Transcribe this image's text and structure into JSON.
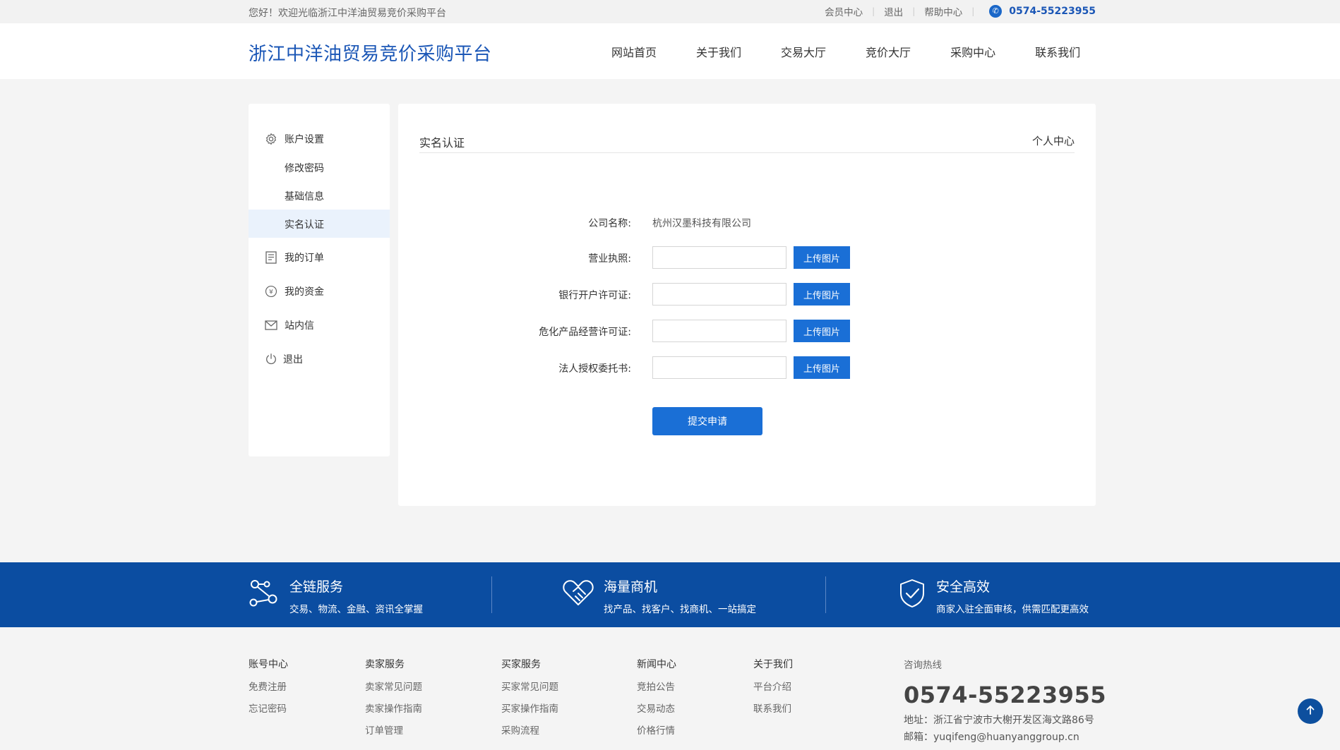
{
  "topbar": {
    "welcome": "您好！欢迎光临浙江中洋油贸易竞价采购平台",
    "links": [
      "会员中心",
      "退出",
      "帮助中心"
    ],
    "phone": "0574-55223955"
  },
  "header": {
    "site_title": "浙江中洋油贸易竞价采购平台",
    "nav": [
      "网站首页",
      "关于我们",
      "交易大厅",
      "竞价大厅",
      "采购中心",
      "联系我们"
    ]
  },
  "sidebar": {
    "account_settings": "账户设置",
    "sub_items": [
      "修改密码",
      "基础信息",
      "实名认证"
    ],
    "active_sub": "实名认证",
    "my_orders": "我的订单",
    "my_funds": "我的资金",
    "messages": "站内信",
    "logout": "退出"
  },
  "main": {
    "title": "实名认证",
    "breadcrumb": "个人中心",
    "company_label": "公司名称:",
    "company_value": "杭州汉墨科技有限公司",
    "upload_rows": [
      {
        "label": "营业执照:",
        "button": "上传图片"
      },
      {
        "label": "银行开户许可证:",
        "button": "上传图片"
      },
      {
        "label": "危化产品经营许可证:",
        "button": "上传图片"
      },
      {
        "label": "法人授权委托书:",
        "button": "上传图片"
      }
    ],
    "submit": "提交申请"
  },
  "features": [
    {
      "title": "全链服务",
      "desc": "交易、物流、金融、资讯全掌握",
      "icon": "network-nodes-icon"
    },
    {
      "title": "海量商机",
      "desc": "找产品、找客户、找商机、一站搞定",
      "icon": "handshake-heart-icon"
    },
    {
      "title": "安全高效",
      "desc": "商家入驻全面审核，供需匹配更高效",
      "icon": "shield-check-icon"
    }
  ],
  "footer": {
    "columns": [
      {
        "head": "账号中心",
        "links": [
          "免费注册",
          "忘记密码"
        ]
      },
      {
        "head": "卖家服务",
        "links": [
          "卖家常见问题",
          "卖家操作指南",
          "订单管理"
        ]
      },
      {
        "head": "买家服务",
        "links": [
          "买家常见问题",
          "买家操作指南",
          "采购流程"
        ]
      },
      {
        "head": "新闻中心",
        "links": [
          "竞拍公告",
          "交易动态",
          "价格行情"
        ]
      },
      {
        "head": "关于我们",
        "links": [
          "平台介绍",
          "联系我们"
        ]
      }
    ],
    "contact": {
      "head": "咨询热线",
      "phone": "0574-55223955",
      "address": "地址：浙江省宁波市大榭开发区海文路86号",
      "email": "邮箱：yuqifeng@huanyanggroup.cn"
    }
  },
  "colors": {
    "brand": "#1a56b6",
    "button": "#1a6fd6",
    "band": "#0b4da1",
    "active_bg": "#eaf2fc"
  }
}
